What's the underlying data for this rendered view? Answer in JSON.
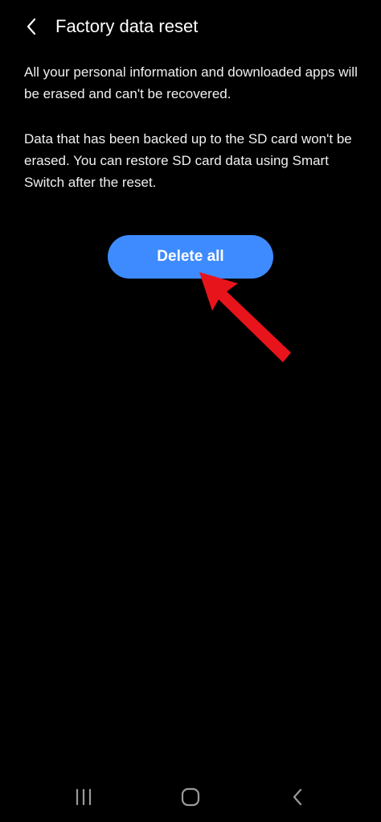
{
  "header": {
    "title": "Factory data reset",
    "back_icon": "chevron-left-icon"
  },
  "content": {
    "paragraph_1": "All your personal information and downloaded apps will be erased and can't be recovered.",
    "paragraph_2": "Data that has been backed up to the SD card won't be erased. You can restore SD card data using Smart Switch after the reset."
  },
  "delete_button": {
    "label": "Delete all"
  },
  "annotation": {
    "arrow_icon": "red-arrow-icon",
    "arrow_color": "#e8141b"
  },
  "navigation_bar": {
    "recents_icon": "recents-icon",
    "home_icon": "home-icon",
    "back_icon": "back-chevron-icon"
  },
  "colors": {
    "background": "#000000",
    "accent": "#3e8bff",
    "text": "#ffffff"
  }
}
